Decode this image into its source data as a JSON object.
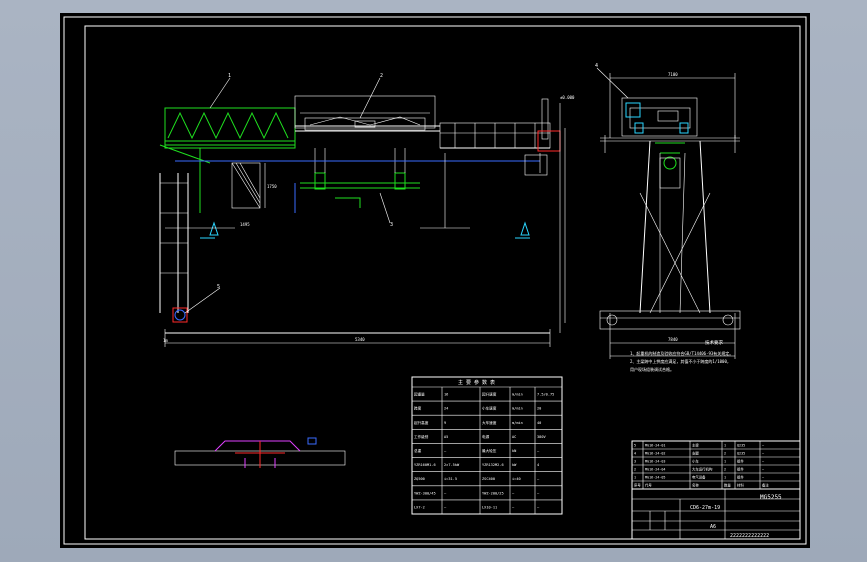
{
  "drawing": {
    "part_labels": [
      "1",
      "2",
      "3",
      "4",
      "5"
    ],
    "dims": {
      "span_total": "5340",
      "left_width": "1495",
      "right_base": "7840",
      "left_height": "1750",
      "right_top": "7100",
      "right_height": "2700",
      "marker": "1m",
      "level_mark": "±0.000"
    },
    "notes_title": "技术要求",
    "notes": [
      "1、起重机的制造及验收应符合GB/T14406-93有关规定。",
      "2、主梁跨中上拱度应满足，其值不小于跨度的1/1000，",
      "   用户现场组装调试合格。"
    ],
    "params_table": {
      "title": "主 要 参 数 表",
      "rows": [
        [
          "起重量",
          "16",
          "起升速度",
          "m/min",
          "7.5/0.75"
        ],
        [
          "跨度",
          "24",
          "小车速度",
          "m/min",
          "20"
        ],
        [
          "起升高度",
          "9",
          "大车速度",
          "m/min",
          "40"
        ],
        [
          "工作级别",
          "A5",
          "电源",
          "AC",
          "380V"
        ],
        [
          "总重",
          "—",
          "最大轮压",
          "kN",
          "—"
        ],
        [
          "YZR160M1-6",
          "2×7.5kW",
          "YZR132M2-6",
          "kW",
          "4"
        ],
        [
          "ZQ500",
          "i=31.5",
          "ZSC400",
          "i=40",
          "—"
        ],
        [
          "YWZ-300/45",
          "—",
          "YWZ-200/25",
          "—",
          "—"
        ],
        [
          "LX7-2",
          "—",
          "LX10-11",
          "—",
          "—"
        ]
      ]
    },
    "bom_rows": [
      [
        "5",
        "MG16-24-01",
        "主梁",
        "1",
        "Q235",
        "—"
      ],
      [
        "4",
        "MG16-24-02",
        "支腿",
        "2",
        "Q235",
        "—"
      ],
      [
        "3",
        "MG16-24-03",
        "小车",
        "1",
        "组件",
        "—"
      ],
      [
        "2",
        "MG16-24-04",
        "大车运行机构",
        "2",
        "组件",
        "—"
      ],
      [
        "1",
        "MG16-24-05",
        "电气设备",
        "1",
        "组件",
        "—"
      ]
    ],
    "bom_header": [
      "序号",
      "代号",
      "名称",
      "数量",
      "材料",
      "备注"
    ],
    "title_block": {
      "name": "MG5255",
      "drawing_no": "CD6-27m-19",
      "scale": "A6",
      "footer": "2222222222222"
    }
  },
  "colors": {
    "background": "#000000",
    "frame": "#ffffff",
    "structure_green": "#1fe01f",
    "red": "#ff2a2a",
    "blue": "#3a6bff",
    "cyan": "#2ad6ff",
    "magenta": "#e040ff"
  }
}
